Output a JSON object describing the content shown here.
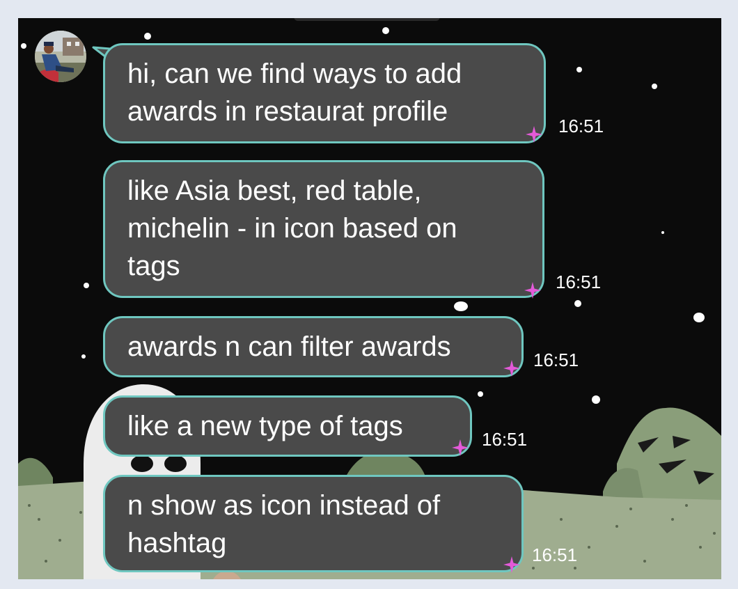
{
  "chat": {
    "sender_avatar": "user-avatar",
    "messages": [
      {
        "text": "hi, can we find ways to add\nawards in restaurat profile",
        "time": "16:51"
      },
      {
        "text": "like Asia best, red table,\nmichelin - in icon based on\ntags",
        "time": "16:51"
      },
      {
        "text": "awards n can filter awards",
        "time": "16:51"
      },
      {
        "text": "like a new type of tags",
        "time": "16:51"
      },
      {
        "text": "n show as icon instead of\nhashtag",
        "time": "16:51"
      }
    ]
  },
  "colors": {
    "page_background": "#e3e8f1",
    "chat_background": "#0b0b0b",
    "bubble_fill": "#4a4a4a",
    "bubble_border": "#6fc7c0",
    "reaction_star": "#e45ad9",
    "grass": "#8a9e7a"
  },
  "icons": {
    "reaction": "star-sparkle-icon"
  }
}
